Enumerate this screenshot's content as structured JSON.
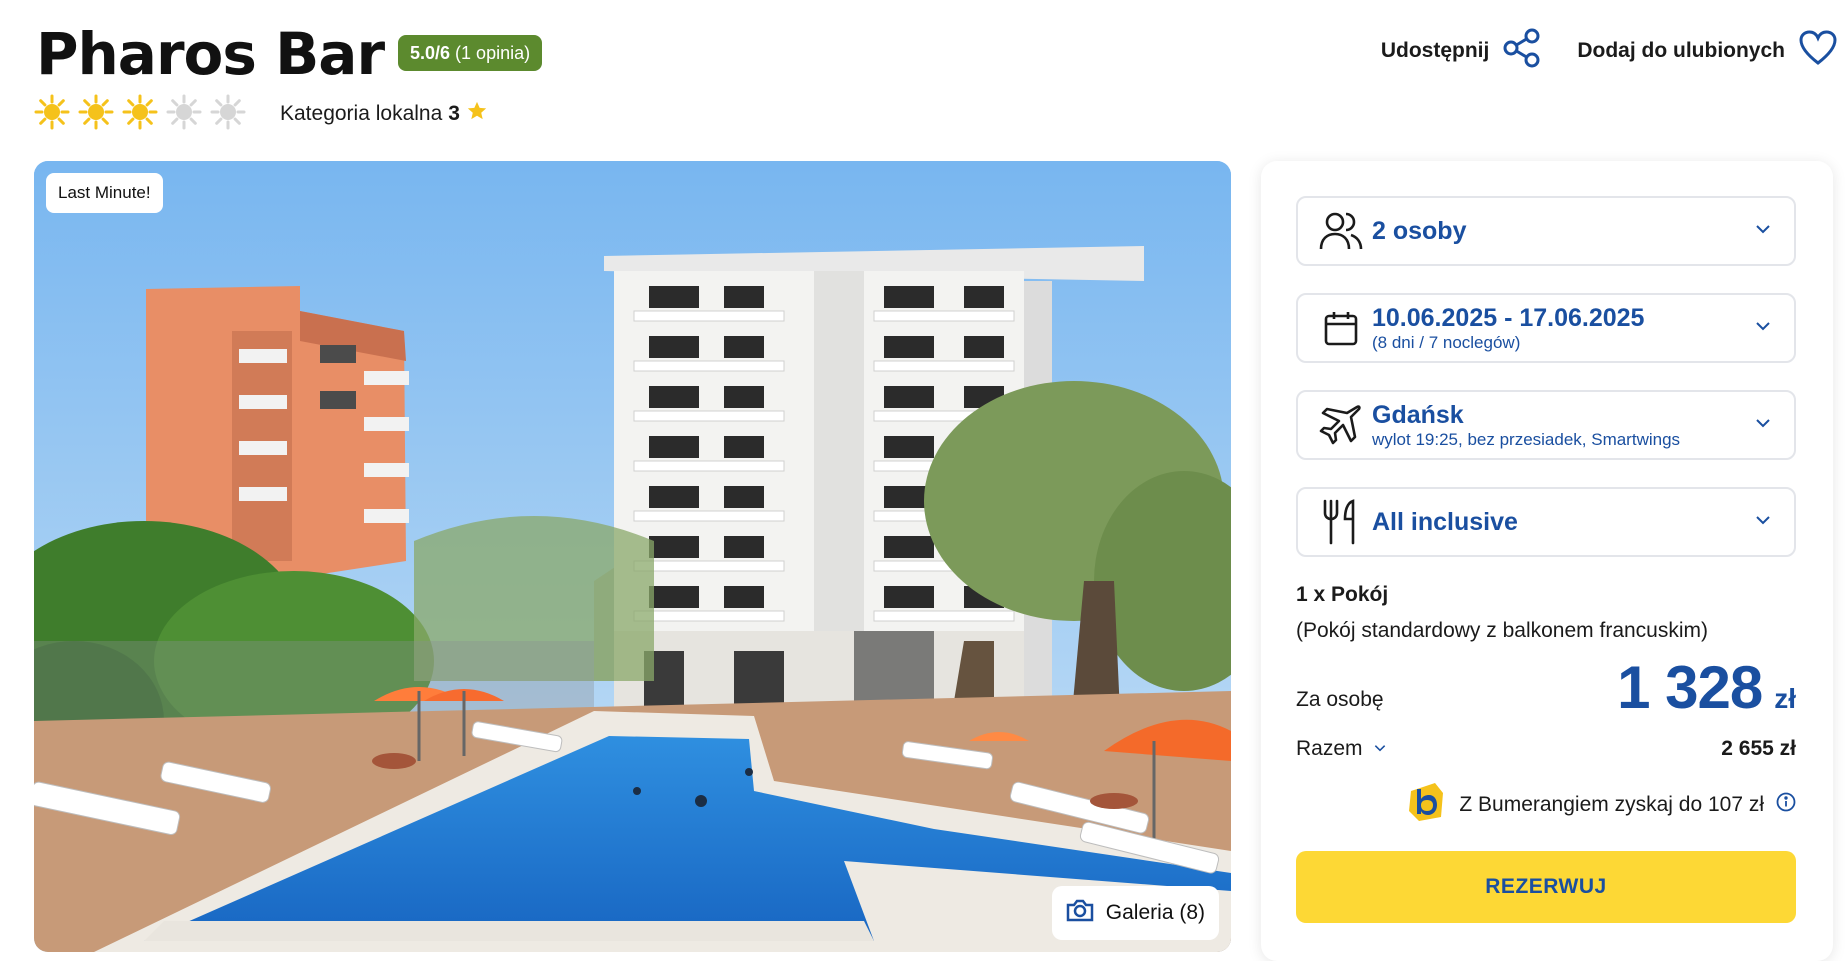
{
  "hotel": {
    "name": "Pharos Bar",
    "rating_score": "5.0/6",
    "rating_count": "(1 opinia)",
    "stars": 3,
    "stars_max": 5,
    "local_category_label": "Kategoria lokalna",
    "local_category_value": "3"
  },
  "header_actions": {
    "share_label": "Udostępnij",
    "favorite_label": "Dodaj do ulubionych"
  },
  "hero": {
    "badge": "Last Minute!",
    "gallery_label": "Galeria (8)"
  },
  "booking": {
    "persons": "2 osoby",
    "dates": "10.06.2025 - 17.06.2025",
    "dates_detail": "(8 dni / 7 noclegów)",
    "departure_city": "Gdańsk",
    "flight_detail": "wylot 19:25, bez przesiadek, Smartwings",
    "board": "All inclusive",
    "room_count": "1 x Pokój",
    "room_type": "(Pokój standardowy z balkonem francuskim)",
    "per_person_label": "Za osobę",
    "price_per_person": "1 328",
    "currency": "zł",
    "total_label": "Razem",
    "total_value": "2 655 zł",
    "bumerang_text": "Z Bumerangiem zyskaj do 107 zł",
    "reserve_label": "REZERWUJ"
  },
  "colors": {
    "brand_blue": "#1a4fa0",
    "rating_green": "#5c8a2e",
    "reserve_yellow": "#fdd835",
    "sun_active": "#f5c21b",
    "sun_inactive": "#d6d6d6"
  },
  "icons": [
    "sun-icon",
    "star-icon",
    "share-icon",
    "heart-icon",
    "camera-icon",
    "persons-icon",
    "calendar-icon",
    "plane-icon",
    "fork-knife-icon",
    "chevron-down-icon",
    "info-icon",
    "bumerang-logo"
  ]
}
